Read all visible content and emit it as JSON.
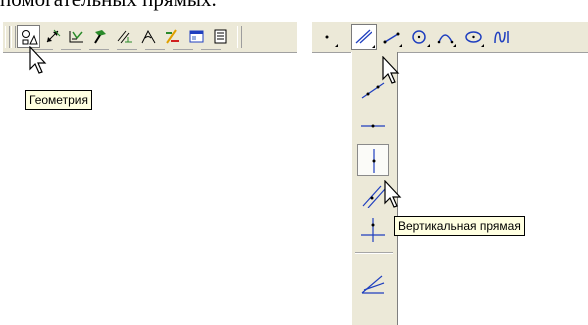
{
  "heading_fragment": "помогательных прямых.",
  "toolbar_left": {
    "buttons": [
      {
        "icon": "geometry-icon",
        "pressed": true
      },
      {
        "icon": "dimensions-icon"
      },
      {
        "icon": "designations-icon"
      },
      {
        "icon": "editing-icon"
      },
      {
        "icon": "parametrization-icon"
      },
      {
        "icon": "measure-icon"
      },
      {
        "icon": "selection-icon"
      },
      {
        "icon": "associative-views-icon"
      },
      {
        "icon": "spec-icon"
      }
    ]
  },
  "toolbar_right": {
    "buttons": [
      {
        "icon": "point-icon"
      },
      {
        "icon": "auxiliary-line-icon",
        "pressed": true
      },
      {
        "icon": "segment-icon"
      },
      {
        "icon": "circle-icon"
      },
      {
        "icon": "arc-icon"
      },
      {
        "icon": "ellipse-icon"
      },
      {
        "icon": "spline-icon"
      }
    ]
  },
  "flyout": {
    "items": [
      {
        "icon": "line-two-points-icon"
      },
      {
        "icon": "horizontal-line-icon"
      },
      {
        "icon": "vertical-line-icon",
        "pressed": true
      },
      {
        "icon": "parallel-line-icon"
      },
      {
        "icon": "perpendicular-line-icon"
      },
      {
        "icon": "bisector-line-icon"
      }
    ]
  },
  "tooltips": {
    "geometry": "Геометрия",
    "vertical_line": "Вертикальная прямая"
  },
  "colors": {
    "toolbar_bg": "#ece9d8",
    "tooltip_bg": "#ffffe1",
    "icon_blue": "#1f3fbf",
    "icon_green": "#2a8a2a",
    "icon_red": "#d02020"
  }
}
